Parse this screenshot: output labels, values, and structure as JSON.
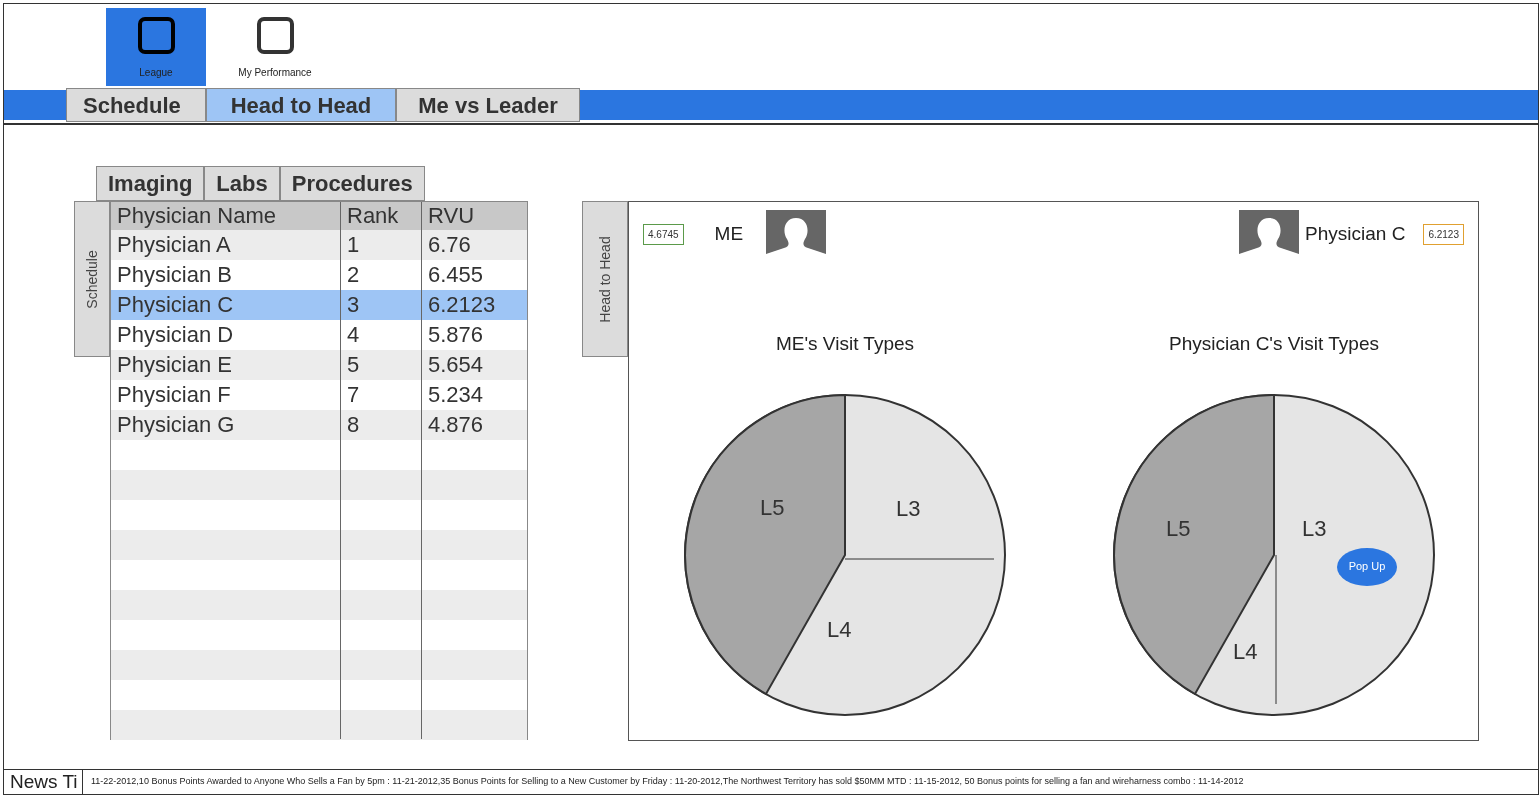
{
  "app_nav": [
    {
      "label": "League",
      "selected": true
    },
    {
      "label": "My Performance",
      "selected": false
    }
  ],
  "tabs": [
    {
      "label": "Schedule",
      "selected": false
    },
    {
      "label": "Head to Head",
      "selected": true
    },
    {
      "label": "Me vs Leader",
      "selected": false
    }
  ],
  "category_tabs": [
    {
      "label": "Imaging"
    },
    {
      "label": "Labs"
    },
    {
      "label": "Procedures"
    }
  ],
  "schedule_side_tab": "Schedule",
  "table": {
    "columns": [
      "Physician Name",
      "Rank",
      "RVU"
    ],
    "rows": [
      {
        "cells": [
          "Physician A",
          "1",
          "6.76"
        ],
        "selected": false
      },
      {
        "cells": [
          "Physician B",
          "2",
          "6.455"
        ],
        "selected": false
      },
      {
        "cells": [
          "Physician C",
          "3",
          "6.2123"
        ],
        "selected": true
      },
      {
        "cells": [
          "Physician D",
          "4",
          "5.876"
        ],
        "selected": false
      },
      {
        "cells": [
          "Physician E",
          "5",
          "5.654"
        ],
        "selected": false
      },
      {
        "cells": [
          "Physician F",
          "7",
          "5.234"
        ],
        "selected": false
      },
      {
        "cells": [
          "Physician G",
          "8",
          "4.876"
        ],
        "selected": false
      }
    ]
  },
  "head_to_head": {
    "side_tab": "Head to Head",
    "players": [
      {
        "score": "4.6745",
        "name": "ME",
        "color": "#5b9a4a"
      },
      {
        "score": "6.2123",
        "name": "Physician C",
        "color": "#e0a030"
      }
    ],
    "charts": [
      {
        "kind": "three-way",
        "title": "ME's Visit Types",
        "labels": [
          "L5",
          "L3",
          "L4"
        ]
      },
      {
        "kind": "half",
        "title": "Physician C's Visit Types",
        "labels": [
          "L5",
          "L3",
          "L4"
        ],
        "popup": "Pop Up"
      }
    ]
  },
  "news_ticker": {
    "label": "News Ti",
    "text": "11-22-2012,10 Bonus Points Awarded to Anyone Who Sells a Fan by 5pm : 11-21-2012,35 Bonus Points for Selling to a New Customer by Friday : 11-20-2012,The Northwest Territory has sold $50MM MTD : 11-15-2012, 50 Bonus points for selling a fan and wireharness combo : 11-14-2012"
  }
}
